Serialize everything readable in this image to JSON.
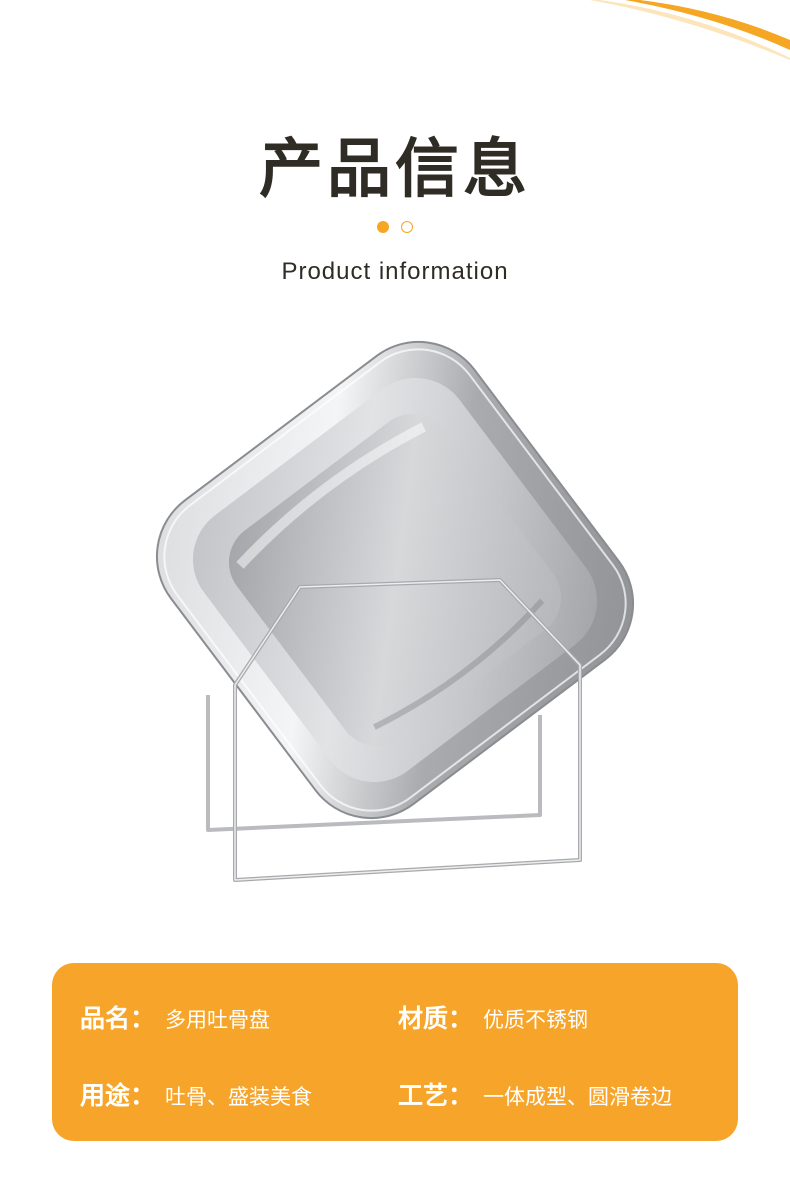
{
  "header": {
    "title_cn": "产品信息",
    "title_en": "Product information"
  },
  "colors": {
    "accent": "#f5a623",
    "card_background": "#f7a52a",
    "title_text": "#2f2c25"
  },
  "product_image": {
    "icon": "stainless-steel-bone-dish-with-wire-stand"
  },
  "info": {
    "name_key": "品名：",
    "name_val": "多用吐骨盘",
    "material_key": "材质：",
    "material_val": "优质不锈钢",
    "usage_key": "用途：",
    "usage_val": "吐骨、盛装美食",
    "craft_key": "工艺：",
    "craft_val": "一体成型、圆滑卷边"
  }
}
